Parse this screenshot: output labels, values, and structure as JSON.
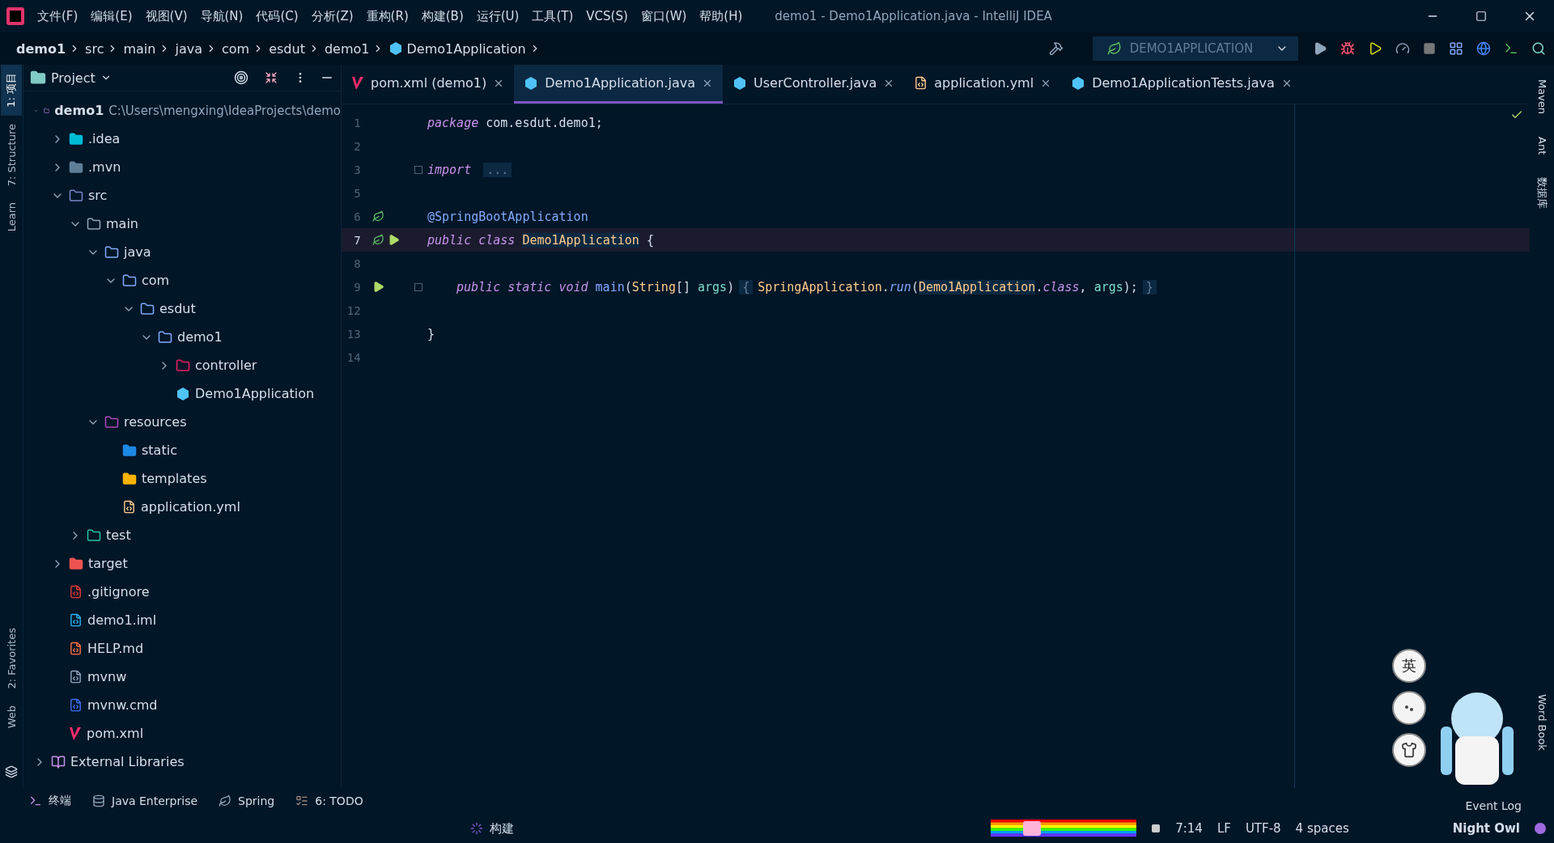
{
  "menu": [
    "文件(F)",
    "编辑(E)",
    "视图(V)",
    "导航(N)",
    "代码(C)",
    "分析(Z)",
    "重构(R)",
    "构建(B)",
    "运行(U)",
    "工具(T)",
    "VCS(S)",
    "窗口(W)",
    "帮助(H)"
  ],
  "window": {
    "title": "demo1 - Demo1Application.java - IntelliJ IDEA"
  },
  "breadcrumb": [
    {
      "label": "demo1",
      "kind": "root"
    },
    {
      "label": "src",
      "kind": "dir"
    },
    {
      "label": "main",
      "kind": "dir"
    },
    {
      "label": "java",
      "kind": "dir"
    },
    {
      "label": "com",
      "kind": "dir"
    },
    {
      "label": "esdut",
      "kind": "dir"
    },
    {
      "label": "demo1",
      "kind": "dir"
    },
    {
      "label": "Demo1Application",
      "kind": "class"
    }
  ],
  "run_config": "DEMO1APPLICATION",
  "left_tools": [
    {
      "label": "1: 项目",
      "selected": true
    },
    {
      "label": "7: Structure",
      "selected": false
    },
    {
      "label": "Learn",
      "selected": false
    }
  ],
  "left_tools_bottom": [
    {
      "label": "2: Favorites",
      "selected": false
    },
    {
      "label": "Web",
      "selected": false
    }
  ],
  "right_tools": [
    {
      "label": "Maven"
    },
    {
      "label": "Ant"
    },
    {
      "label": "数据库"
    }
  ],
  "right_tools_bottom": [
    {
      "label": "Word Book"
    }
  ],
  "project": {
    "title": "Project",
    "tree": [
      {
        "name": "demo1",
        "path": "C:\\Users\\mengxing\\IdeaProjects\\demo",
        "kind": "module",
        "expanded": true,
        "children": [
          {
            "name": ".idea",
            "kind": "idea",
            "expanded": false
          },
          {
            "name": ".mvn",
            "kind": "folder-gray",
            "expanded": false
          },
          {
            "name": "src",
            "kind": "src",
            "expanded": true,
            "children": [
              {
                "name": "main",
                "kind": "folder",
                "expanded": true,
                "children": [
                  {
                    "name": "java",
                    "kind": "source",
                    "expanded": true,
                    "children": [
                      {
                        "name": "com",
                        "kind": "package",
                        "expanded": true,
                        "children": [
                          {
                            "name": "esdut",
                            "kind": "package",
                            "expanded": true,
                            "children": [
                              {
                                "name": "demo1",
                                "kind": "package",
                                "expanded": true,
                                "children": [
                                  {
                                    "name": "controller",
                                    "kind": "controller",
                                    "expanded": false
                                  },
                                  {
                                    "name": "Demo1Application",
                                    "kind": "class"
                                  }
                                ]
                              }
                            ]
                          }
                        ]
                      }
                    ]
                  },
                  {
                    "name": "resources",
                    "kind": "resources",
                    "expanded": true,
                    "children": [
                      {
                        "name": "static",
                        "kind": "static"
                      },
                      {
                        "name": "templates",
                        "kind": "templates"
                      },
                      {
                        "name": "application.yml",
                        "kind": "yaml"
                      }
                    ]
                  }
                ]
              },
              {
                "name": "test",
                "kind": "test",
                "expanded": false
              }
            ]
          },
          {
            "name": "target",
            "kind": "target",
            "expanded": false
          },
          {
            "name": ".gitignore",
            "kind": "git"
          },
          {
            "name": "demo1.iml",
            "kind": "iml"
          },
          {
            "name": "HELP.md",
            "kind": "md"
          },
          {
            "name": "mvnw",
            "kind": "binary"
          },
          {
            "name": "mvnw.cmd",
            "kind": "cmd"
          },
          {
            "name": "pom.xml",
            "kind": "maven"
          }
        ]
      },
      {
        "name": "External Libraries",
        "kind": "libraries",
        "expanded": false
      }
    ]
  },
  "tabs": [
    {
      "label": "pom.xml (demo1)",
      "kind": "maven",
      "selected": false
    },
    {
      "label": "Demo1Application.java",
      "kind": "spring-class",
      "selected": true
    },
    {
      "label": "UserController.java",
      "kind": "class",
      "selected": false
    },
    {
      "label": "application.yml",
      "kind": "yaml",
      "selected": false
    },
    {
      "label": "Demo1ApplicationTests.java",
      "kind": "class",
      "selected": false
    }
  ],
  "code": [
    {
      "n": "1",
      "current": false,
      "tokens": [
        {
          "t": "package ",
          "kind": "kw"
        },
        {
          "t": "com.esdut.demo1;",
          "kind": "plain"
        }
      ]
    },
    {
      "n": "2",
      "current": false
    },
    {
      "n": "3",
      "current": false,
      "fold": true,
      "tokens": [
        {
          "t": "import ",
          "kind": "kw"
        },
        {
          "t": "...",
          "kind": "folded"
        }
      ]
    },
    {
      "n": "5",
      "current": false
    },
    {
      "n": "6",
      "current": false,
      "bean": true,
      "tokens": [
        {
          "t": "@SpringBootApplication",
          "kind": "ann"
        }
      ]
    },
    {
      "n": "7",
      "current": true,
      "bean": true,
      "run": true,
      "tokens": [
        {
          "t": "public class ",
          "kind": "kw"
        },
        {
          "t": "Demo1Application",
          "kind": "typehl"
        },
        {
          "t": " {",
          "kind": "plain"
        }
      ]
    },
    {
      "n": "8",
      "current": false
    },
    {
      "n": "9",
      "current": false,
      "run": true,
      "fold": true,
      "tokens": [
        {
          "t": "public static void ",
          "kind": "kw"
        },
        {
          "t": "main",
          "kind": "fn"
        },
        {
          "t": "(",
          "kind": "plain"
        },
        {
          "t": "String",
          "kind": "type"
        },
        {
          "t": "[] ",
          "kind": "plain"
        },
        {
          "t": "args",
          "kind": "param"
        },
        {
          "t": ")",
          "kind": "plain"
        },
        {
          "t": "{",
          "kind": "folded"
        },
        {
          "t": "SpringApplication",
          "kind": "type"
        },
        {
          "t": ".",
          "kind": "plain"
        },
        {
          "t": "run",
          "kind": "fnit"
        },
        {
          "t": "(",
          "kind": "plain"
        },
        {
          "t": "Demo1Application",
          "kind": "typehl"
        },
        {
          "t": ".",
          "kind": "plain"
        },
        {
          "t": "class",
          "kind": "kw"
        },
        {
          "t": ", ",
          "kind": "plain"
        },
        {
          "t": "args",
          "kind": "param"
        },
        {
          "t": ");",
          "kind": "plain"
        },
        {
          "t": "}",
          "kind": "folded"
        }
      ]
    },
    {
      "n": "12",
      "current": false
    },
    {
      "n": "13",
      "current": false,
      "tokens": [
        {
          "t": "}",
          "kind": "plain"
        }
      ]
    },
    {
      "n": "14",
      "current": false
    }
  ],
  "mascot": {
    "language_button": "英"
  },
  "bottom_tools": [
    {
      "label": "终端",
      "kind": "terminal"
    },
    {
      "label": "Java Enterprise",
      "kind": "enterprise"
    },
    {
      "label": "Spring",
      "kind": "spring"
    },
    {
      "label": "6: TODO",
      "kind": "todo"
    }
  ],
  "event_log": "Event Log",
  "status": {
    "task": "构建",
    "items": [
      "7:14",
      "LF",
      "UTF-8",
      "4 spaces"
    ],
    "theme": "Night Owl"
  }
}
